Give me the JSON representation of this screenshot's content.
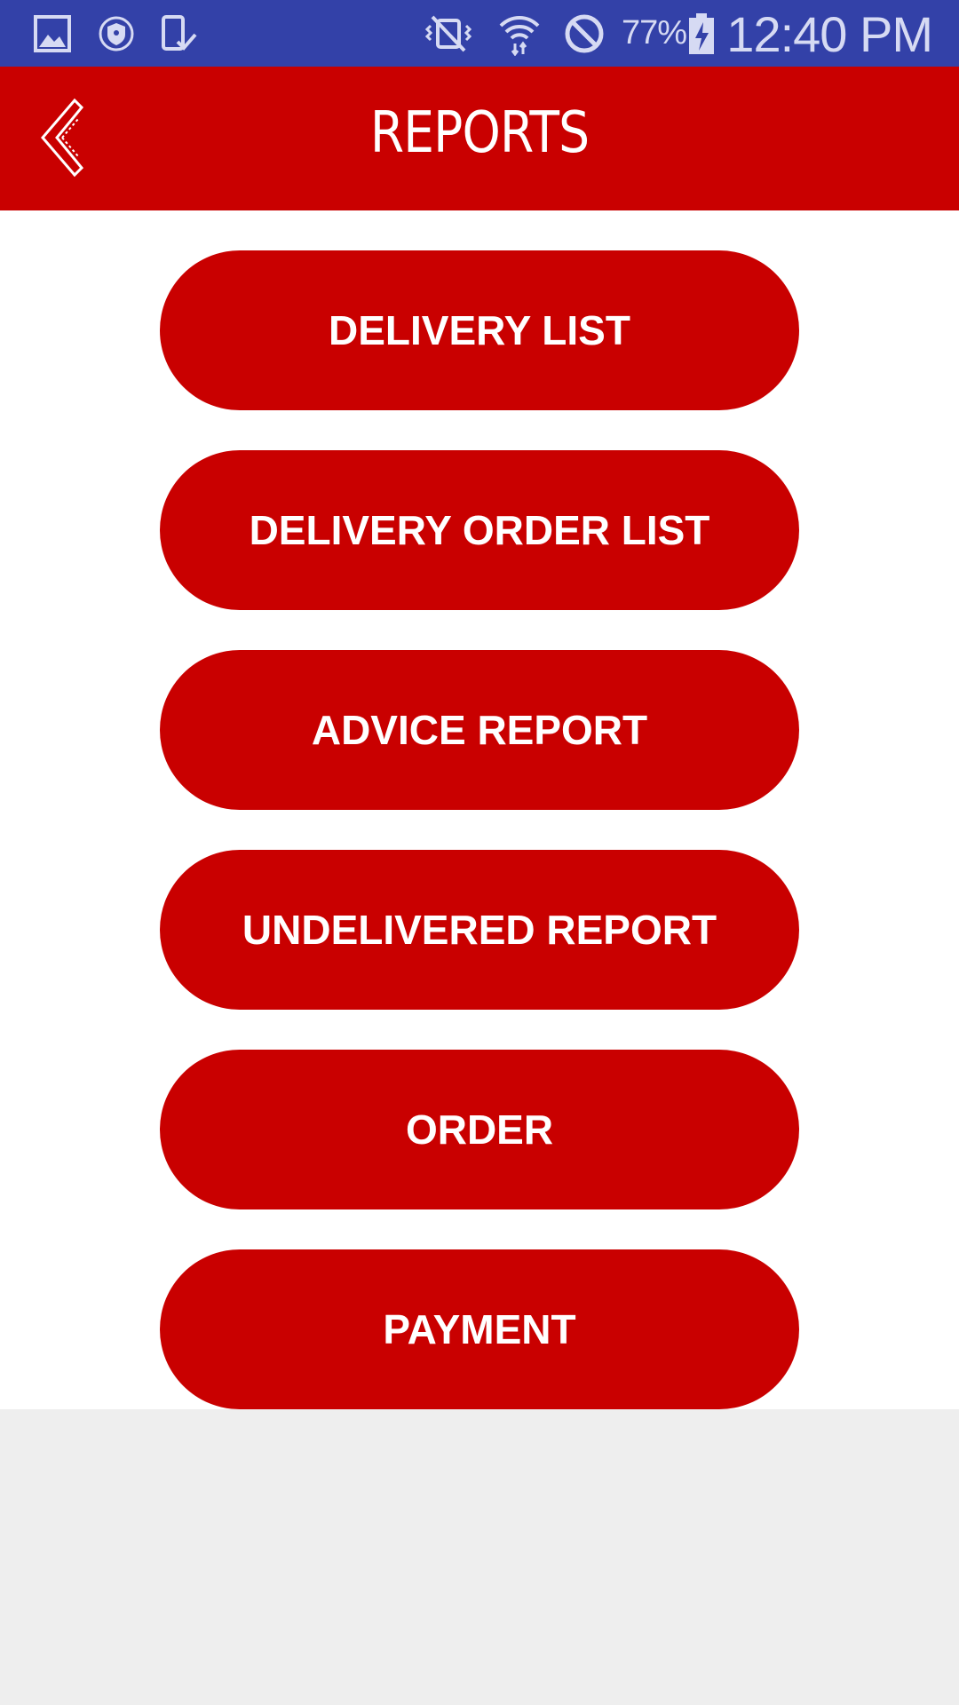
{
  "status_bar": {
    "battery_percent": "77%",
    "time": "12:40 PM",
    "icons": [
      "gallery-icon",
      "vpn-shield-icon",
      "device-check-icon",
      "vibrate-mute-icon",
      "wifi-icon",
      "do-not-disturb-icon",
      "battery-charging-icon"
    ]
  },
  "app_bar": {
    "title": "REPORTS",
    "back_icon": "chevron-left-icon"
  },
  "menu": {
    "items": [
      {
        "label": "DELIVERY LIST"
      },
      {
        "label": "DELIVERY ORDER LIST"
      },
      {
        "label": "ADVICE REPORT"
      },
      {
        "label": "UNDELIVERED REPORT"
      },
      {
        "label": "ORDER"
      },
      {
        "label": "PAYMENT"
      }
    ]
  },
  "colors": {
    "status_bar": "#3341a8",
    "accent": "#c90000",
    "background": "#ffffff",
    "empty_area": "#eeeeee"
  }
}
